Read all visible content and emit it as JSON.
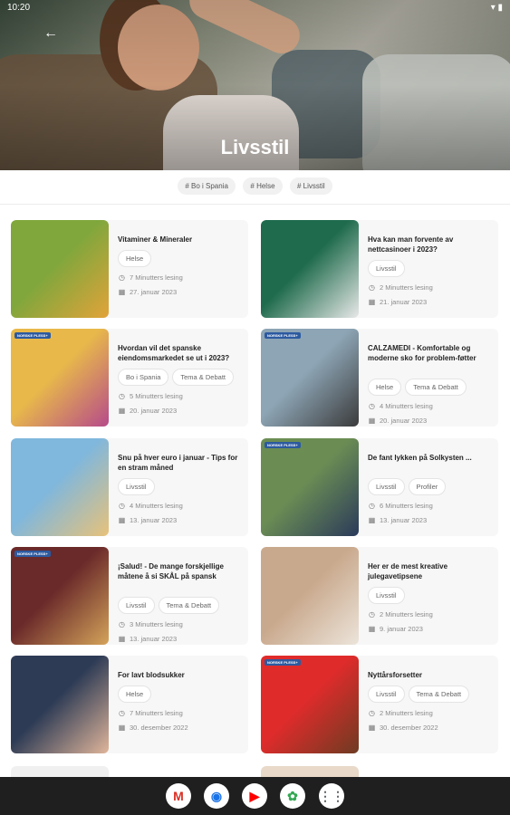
{
  "status": {
    "time": "10:20",
    "icons": "▾ ▮"
  },
  "header": {
    "title": "Livsstil",
    "back_label": "←"
  },
  "chips": [
    "# Bo i Spania",
    "# Helse",
    "# Livsstil"
  ],
  "articles": [
    {
      "title": "Vitaminer & Mineraler",
      "tags": [
        "Helse"
      ],
      "read": "7 Minutters lesing",
      "date": "27. januar 2023",
      "colors": [
        "#7fa73c",
        "#e1a33a"
      ]
    },
    {
      "title": "Hva kan man forvente av nettcasinoer i 2023?",
      "tags": [
        "Livsstil"
      ],
      "read": "2 Minutters lesing",
      "date": "21. januar 2023",
      "colors": [
        "#1f6b4d",
        "#e8e8e8"
      ]
    },
    {
      "title": "Hvordan vil det spanske eiendomsmarkedet se ut i 2023?",
      "tags": [
        "Bo i Spania",
        "Tema & Debatt"
      ],
      "read": "5 Minutters lesing",
      "date": "20. januar 2023",
      "colors": [
        "#e8b94a",
        "#b64a8a"
      ],
      "badge": "NORSKE PLESS+"
    },
    {
      "title": "CALZAMEDI - Komfortable og moderne sko for problem-føtter",
      "tags": [
        "Helse",
        "Tema & Debatt"
      ],
      "read": "4 Minutters lesing",
      "date": "20. januar 2023",
      "colors": [
        "#8da5b5",
        "#3b3b3b"
      ],
      "badge": "NORSKE PLESS+"
    },
    {
      "title": "Snu på hver euro i januar - Tips for en stram måned",
      "tags": [
        "Livsstil"
      ],
      "read": "4 Minutters lesing",
      "date": "13. januar 2023",
      "colors": [
        "#7fb7dd",
        "#e7c27a"
      ]
    },
    {
      "title": "De fant lykken på Solkysten ...",
      "tags": [
        "Livsstil",
        "Profiler"
      ],
      "read": "6 Minutters lesing",
      "date": "13. januar 2023",
      "colors": [
        "#6b8d54",
        "#2a3a5a"
      ],
      "badge": "NORSKE PLESS+"
    },
    {
      "title": "¡Salud! - De mange forskjellige måtene å si SKÅL på spansk",
      "tags": [
        "Livsstil",
        "Tema & Debatt"
      ],
      "read": "3 Minutters lesing",
      "date": "13. januar 2023",
      "colors": [
        "#6a2a2a",
        "#d4a35a"
      ],
      "badge": "NORSKE PLESS+"
    },
    {
      "title": "Her er de mest kreative julegavetipsene",
      "tags": [
        "Livsstil"
      ],
      "read": "2 Minutters lesing",
      "date": "9. januar 2023",
      "colors": [
        "#c9a98d",
        "#ece4da"
      ]
    },
    {
      "title": "For lavt blodsukker",
      "tags": [
        "Helse"
      ],
      "read": "7 Minutters lesing",
      "date": "30. desember 2022",
      "colors": [
        "#2d3b55",
        "#e0b59a"
      ]
    },
    {
      "title": "Nyttårsforsetter",
      "tags": [
        "Livsstil",
        "Tema & Debatt"
      ],
      "read": "2 Minutters lesing",
      "date": "30. desember 2022",
      "colors": [
        "#e02b2b",
        "#6e3b22"
      ],
      "badge": "NORSKE PLESS+"
    }
  ],
  "dock": [
    {
      "name": "gmail",
      "glyph": "M",
      "color": "#d93025"
    },
    {
      "name": "chrome",
      "glyph": "◉",
      "color": "#1a73e8"
    },
    {
      "name": "youtube",
      "glyph": "▶",
      "color": "#ff0000"
    },
    {
      "name": "photos",
      "glyph": "✿",
      "color": "#34a853"
    },
    {
      "name": "apps",
      "glyph": "⋮⋮",
      "color": "#5f6368"
    }
  ]
}
